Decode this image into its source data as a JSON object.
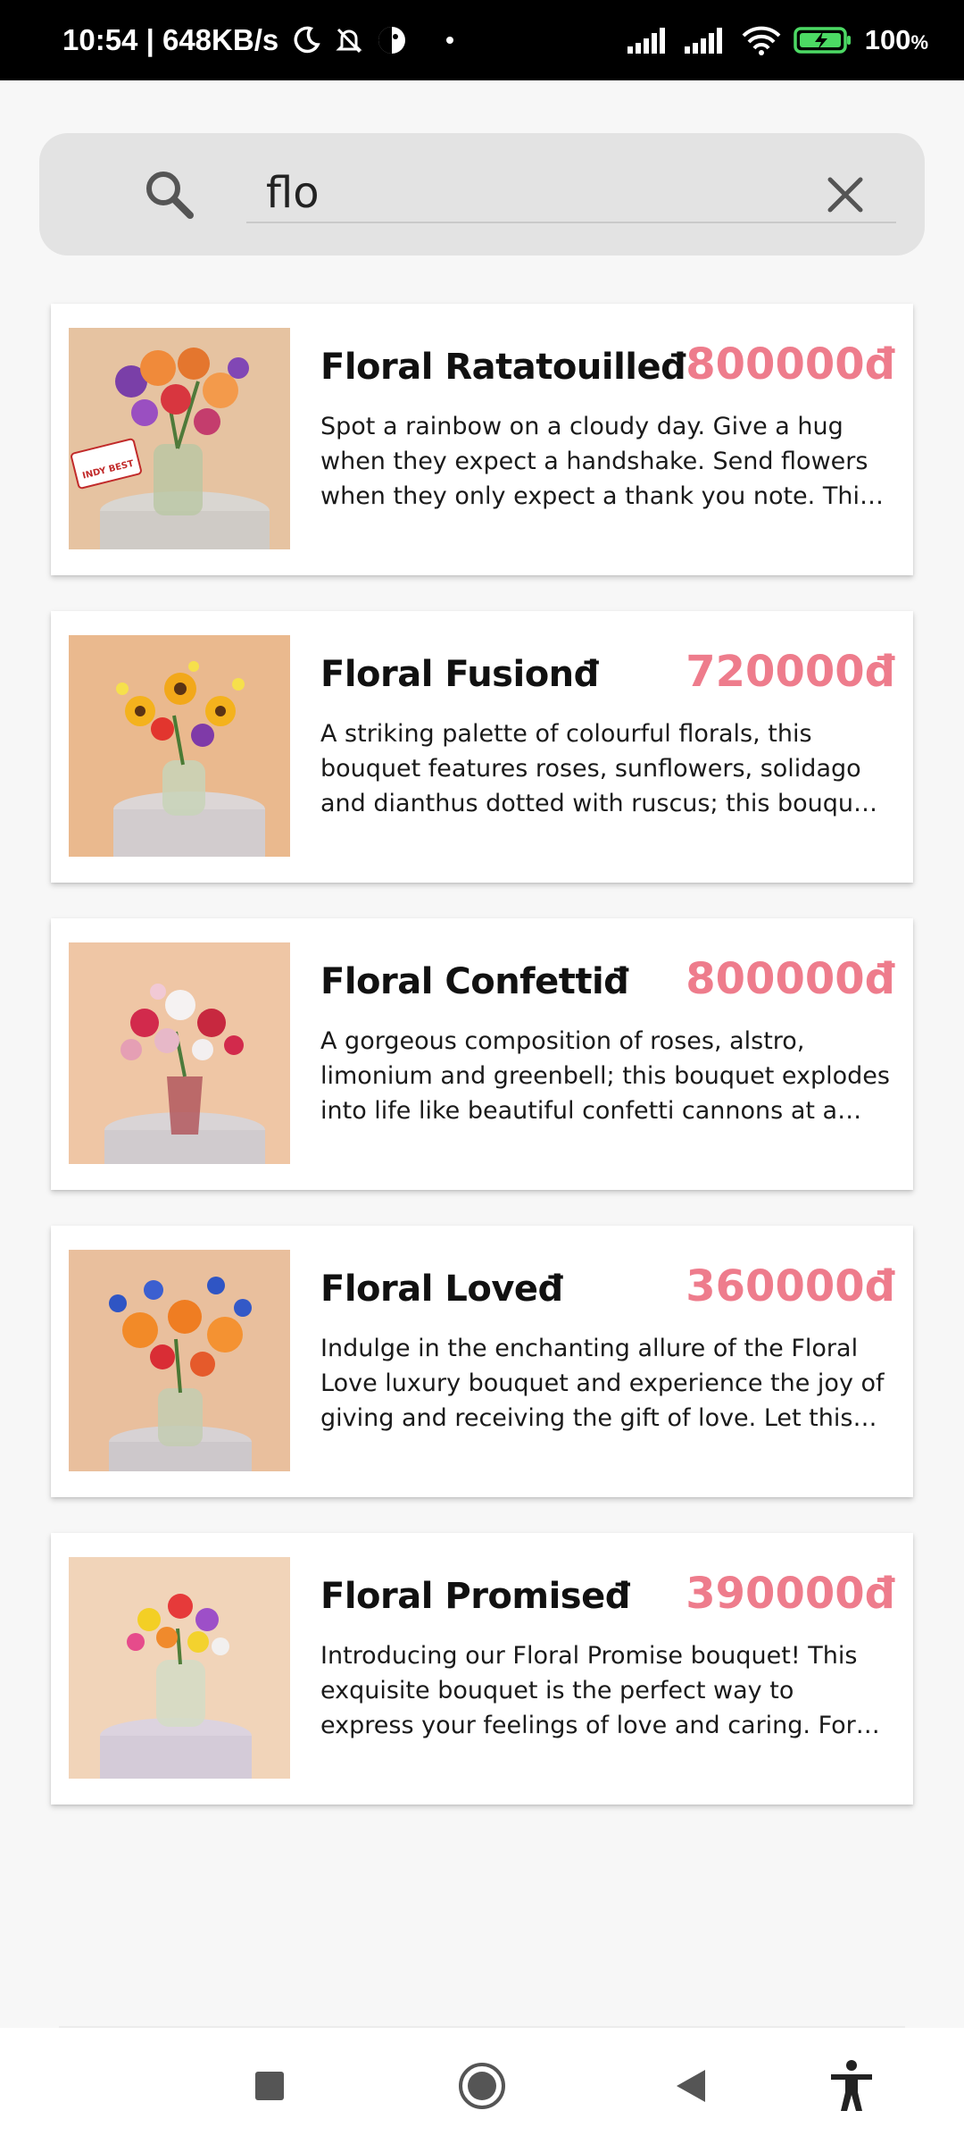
{
  "status_bar": {
    "time_speed": "10:54 | 648KB/s",
    "battery_percent": "100",
    "battery_unit": "%"
  },
  "search": {
    "value": "flo",
    "placeholder": ""
  },
  "colors": {
    "price": "#ee7c8c",
    "search_bg": "#e3e3e3",
    "page_bg": "#f7f7f7"
  },
  "products": [
    {
      "name": "Floral Ratatouilleđ",
      "price": "800000đ",
      "description": "Spot a rainbow on a cloudy day. Give a hug when they expect a handshake. Send flowers when they only expect a thank you note. This bouquet is for every kind of moment.",
      "badge_text": "INDY BEST"
    },
    {
      "name": "Floral Fusionđ",
      "price": "720000đ",
      "description": "A striking palette of colourful florals, this bouquet features roses, sunflowers, solidago and dianthus dotted with ruscus; this bouquet is a joy to receive."
    },
    {
      "name": "Floral Confettiđ",
      "price": "800000đ",
      "description": "A gorgeous composition of roses, alstro, limonium and greenbell; this bouquet explodes into life like beautiful confetti cannons at a celebration."
    },
    {
      "name": "Floral Loveđ",
      "price": "360000đ",
      "description": "Indulge in the enchanting allure of the Floral Love luxury bouquet and experience the joy of giving and receiving the gift of love. Let this bouquet speak for you."
    },
    {
      "name": "Floral Promiseđ",
      "price": "390000đ",
      "description": "Introducing our Floral Promise bouquet! This exquisite bouquet is the perfect way to express your feelings of love and caring. For someone special."
    }
  ],
  "nav": {
    "icons": [
      "square-icon",
      "circle-home-icon",
      "back-triangle-icon",
      "accessibility-icon"
    ]
  }
}
